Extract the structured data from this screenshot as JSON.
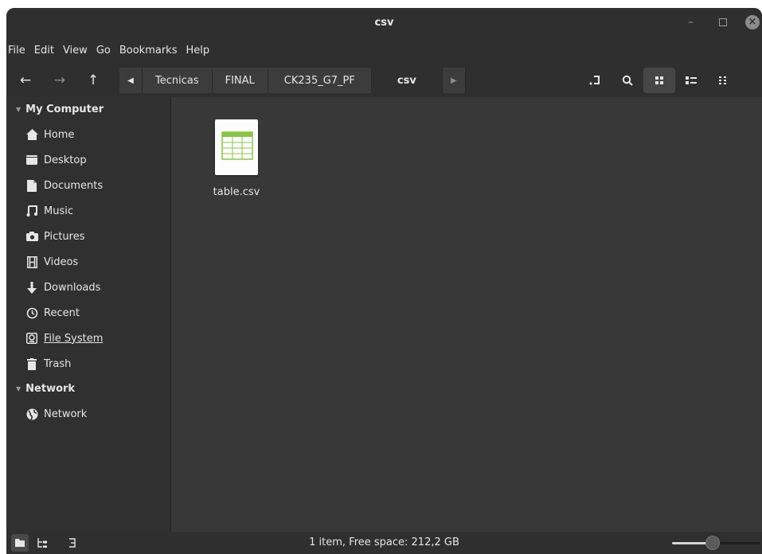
{
  "window": {
    "title": "csv"
  },
  "menu": [
    "File",
    "Edit",
    "View",
    "Go",
    "Bookmarks",
    "Help"
  ],
  "nav": {
    "back_icon": "arrow-left-icon",
    "forward_icon": "arrow-right-icon",
    "up_icon": "arrow-up-icon"
  },
  "breadcrumbs": [
    "Tecnicas",
    "FINAL",
    "CK235_G7_PF",
    "csv"
  ],
  "sidebar": {
    "computer_header": "My Computer",
    "places": [
      {
        "label": "Home",
        "icon": "home-icon"
      },
      {
        "label": "Desktop",
        "icon": "desktop-icon"
      },
      {
        "label": "Documents",
        "icon": "document-icon"
      },
      {
        "label": "Music",
        "icon": "music-icon"
      },
      {
        "label": "Pictures",
        "icon": "camera-icon"
      },
      {
        "label": "Videos",
        "icon": "film-icon"
      },
      {
        "label": "Downloads",
        "icon": "download-icon"
      },
      {
        "label": "Recent",
        "icon": "recent-icon"
      },
      {
        "label": "File System",
        "icon": "drive-icon"
      },
      {
        "label": "Trash",
        "icon": "trash-icon"
      }
    ],
    "network_header": "Network",
    "network_items": [
      {
        "label": "Network",
        "icon": "globe-icon"
      }
    ]
  },
  "files": [
    {
      "name": "table.csv",
      "icon": "spreadsheet-file-icon"
    }
  ],
  "status": {
    "text": "1 item, Free space: 212,2 GB",
    "zoom_level": 0.45
  },
  "colors": {
    "window_bg": "#383838",
    "sidebar_bg": "#303030",
    "header_bg": "#2f2f2f",
    "csv_green": "#8bc34a"
  }
}
